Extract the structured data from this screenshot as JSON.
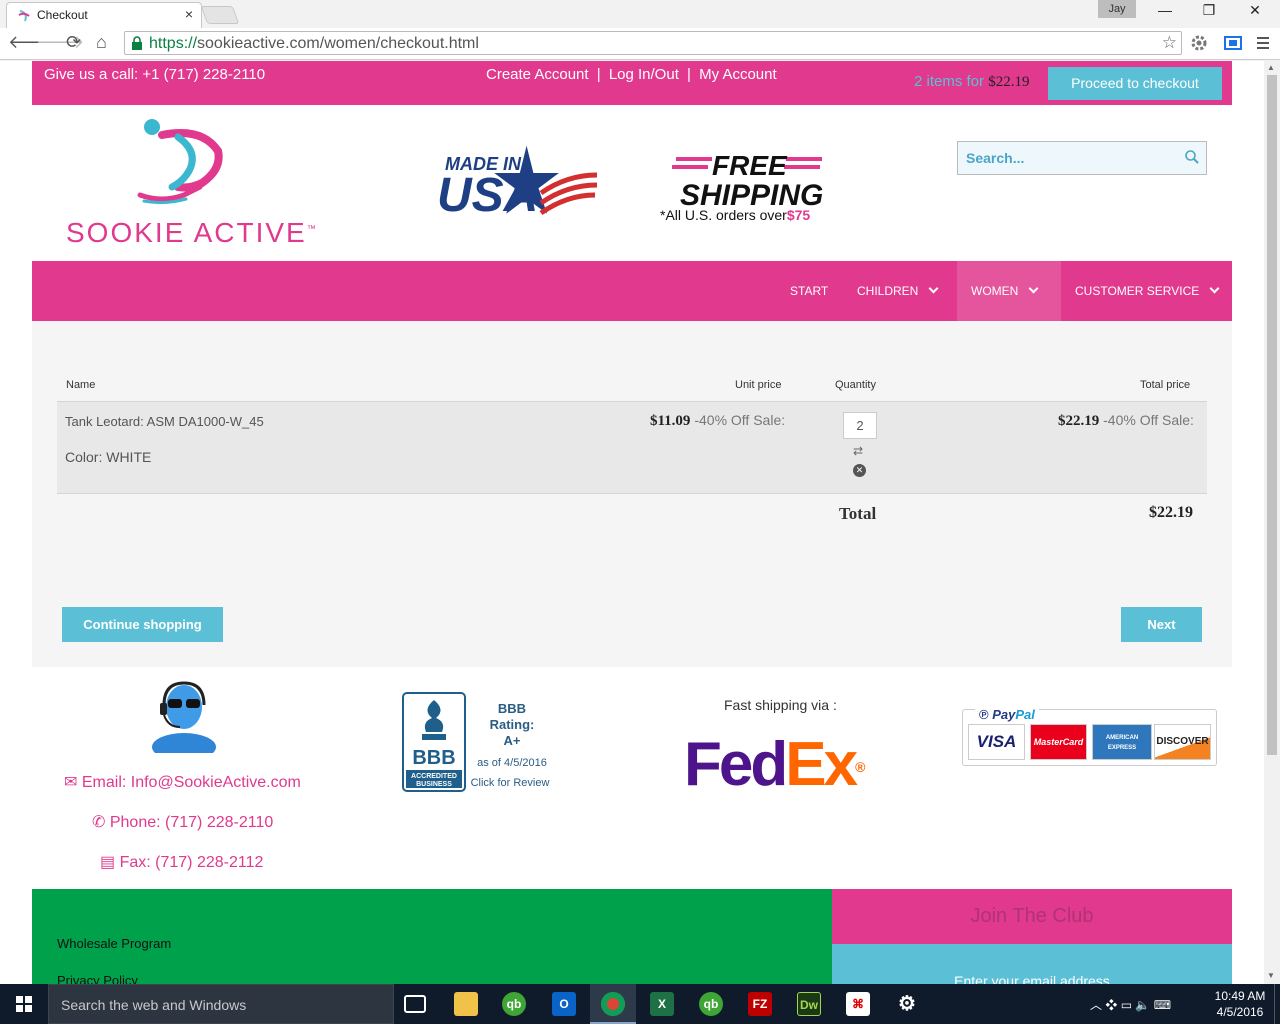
{
  "browser": {
    "tab_title": "Checkout",
    "user_name": "Jay",
    "url_https": "https://",
    "url_rest": "sookieactive.com/women/checkout.html"
  },
  "topbar": {
    "call": "Give us a call: +1 (717) 228-2110",
    "create_account": "Create Account",
    "sep1": "|",
    "login": "Log In/Out",
    "sep2": "|",
    "my_account": "My Account",
    "cart_count": "2 items for",
    "cart_total": "$22.19",
    "checkout_label": "Proceed to checkout"
  },
  "header": {
    "logo_text": "SOOKIE ACTIVE",
    "logo_tm": "™",
    "made_in": "MADE IN",
    "usa": "USA",
    "free": "FREE",
    "shipping": "SHIPPING",
    "ship_note": "*All U.S. orders over",
    "ship_amount": "$75",
    "search_placeholder": "Search..."
  },
  "menu": [
    {
      "label": "START"
    },
    {
      "label": "CHILDREN"
    },
    {
      "label": "WOMEN"
    },
    {
      "label": "CUSTOMER SERVICE"
    }
  ],
  "cart_table": {
    "headers": {
      "name": "Name",
      "unit_price": "Unit price",
      "quantity": "Quantity",
      "total_price": "Total price"
    },
    "items": [
      {
        "name": "Tank Leotard: ASM DA1000-W_45",
        "color": "Color: WHITE",
        "unit_price": "$11.09",
        "unit_note": "-40% Off Sale:",
        "quantity": "2",
        "total_price": "$22.19",
        "total_note": "-40% Off Sale:"
      }
    ],
    "total_label": "Total",
    "total_value": "$22.19"
  },
  "buttons": {
    "continue": "Continue shopping",
    "next": "Next"
  },
  "footer": {
    "email": "Email: Info@SookieActive.com",
    "phone": "Phone: (717) 228-2110",
    "fax": "Fax: (717) 228-2112",
    "bbb_title": "BBB",
    "bbb_rating": "Rating:",
    "bbb_grade": "A+",
    "bbb_date": "as of 4/5/2016",
    "bbb_review": "Click for Review",
    "bbb_logo": "BBB",
    "bbb_accredited": "ACCREDITED BUSINESS",
    "fast_shipping": "Fast shipping via :",
    "fedex_fed": "Fed",
    "fedex_ex": "Ex",
    "fedex_reg": "®",
    "paypal_pay": "Pay",
    "paypal_pal": "Pal",
    "cards": [
      "VISA",
      "MasterCard",
      "AMERICAN EXPRESS",
      "DISCOVER"
    ],
    "wholesale": "Wholesale Program",
    "privacy": "Privacy Policy",
    "club_title": "Join The Club",
    "email_placeholder": "Enter your email address"
  },
  "taskbar": {
    "search_placeholder": "Search the web and Windows",
    "time": "10:49 AM",
    "date": "4/5/2016"
  },
  "colors": {
    "brand_pink": "#e0398e",
    "accent_blue": "#5bc0d6",
    "footer_green": "#00a14b"
  }
}
